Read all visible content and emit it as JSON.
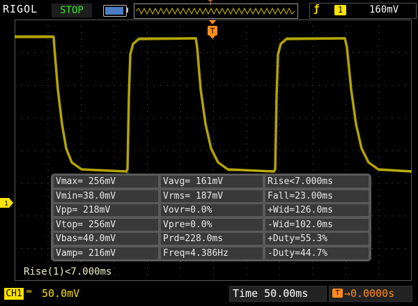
{
  "header": {
    "brand": "RIGOL",
    "run_status": "STOP",
    "trigger_level": "160mV",
    "trigger_channel": "1",
    "trigger_edge_icon": "rising-edge-icon",
    "trigger_marker": "T"
  },
  "channel": {
    "label": "CH1",
    "marker": "1",
    "scale": "50.0mV",
    "coupling_icon": "dc-coupling-icon",
    "color": "#ffe400"
  },
  "timebase": {
    "label": "Time",
    "value": "50.00ms",
    "trigger_offset": "0.0000s",
    "trigger_offset_icon": "T"
  },
  "measurements": [
    [
      "Vmax= 256mV",
      "Vavg= 161mV",
      "Rise<7.000ms"
    ],
    [
      "Vmin=38.0mV",
      "Vrms= 187mV",
      "Fall=23.00ms"
    ],
    [
      "Vpp= 218mV",
      "Vovr=0.0%",
      "+Wid=126.0ms"
    ],
    [
      "Vtop= 256mV",
      "Vpre=0.0%",
      "-Wid=102.0ms"
    ],
    [
      "Vbas=40.0mV",
      "Prd=228.0ms",
      "+Duty=55.3%"
    ],
    [
      "Vamp= 216mV",
      "Freq=4.386Hz",
      "-Duty=44.7%"
    ]
  ],
  "rise_readout": "Rise(1)<7.000ms",
  "waveform": {
    "color": "#b3a400"
  }
}
